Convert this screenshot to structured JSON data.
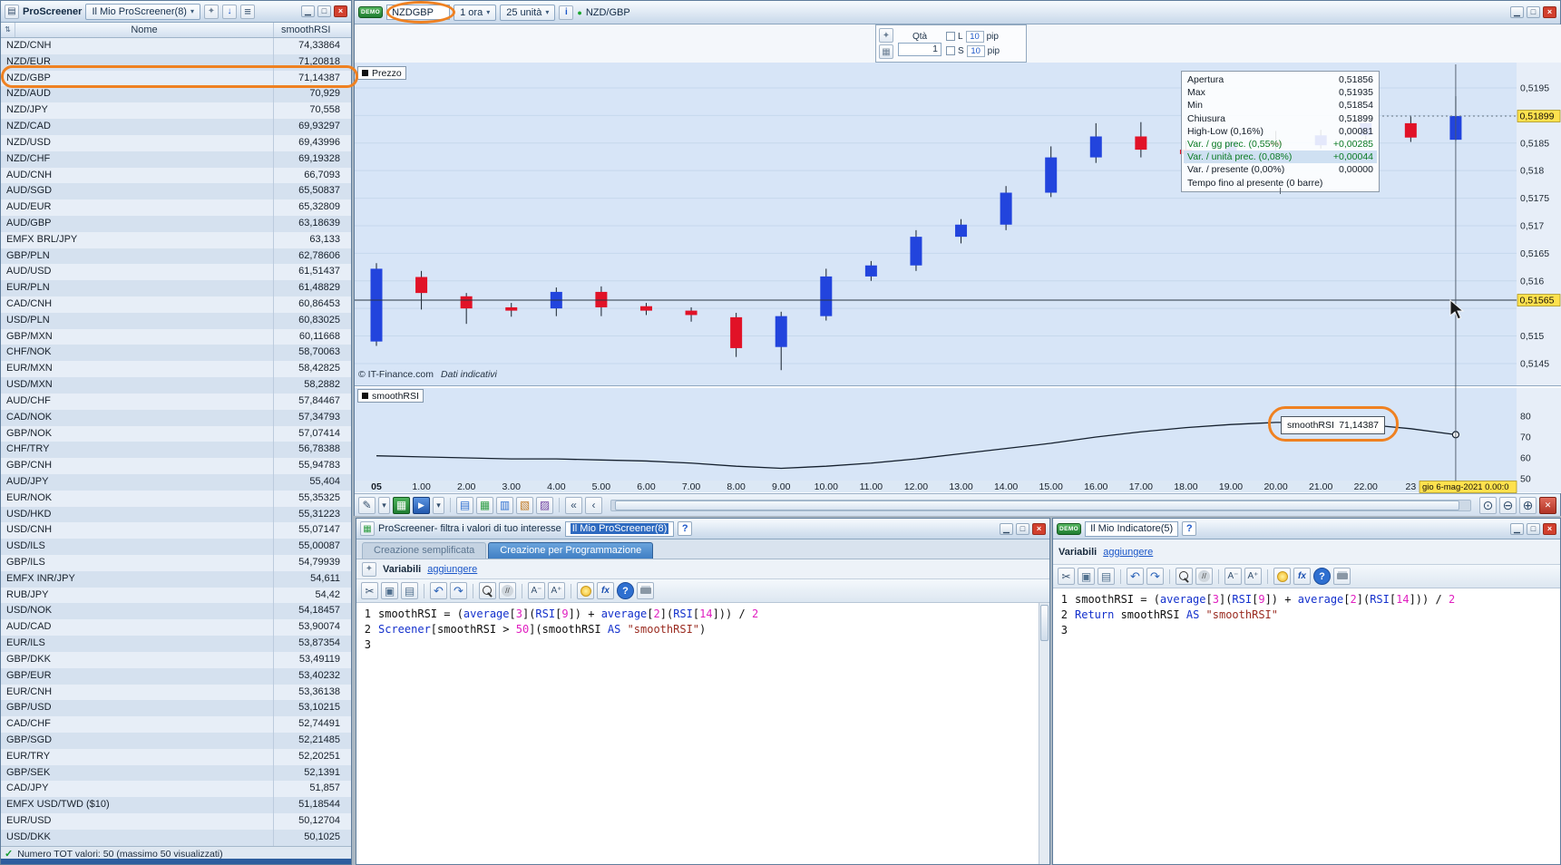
{
  "colors": {
    "up": "#2244dd",
    "down": "#e11227",
    "annotation": "#ef8121",
    "highlight": "#ffe14d",
    "chart_bg": "#d7e5f7"
  },
  "screener_window": {
    "titlebar": {
      "title": "ProScreener",
      "dropdown_label": "Il Mio ProScreener(8)"
    },
    "header": {
      "name_col": "Nome",
      "value_col": "smoothRSI",
      "sort_icon": "⇅"
    },
    "rows": [
      [
        "NZD/CNH",
        "74,33864"
      ],
      [
        "NZD/EUR",
        "71,20818"
      ],
      [
        "NZD/GBP",
        "71,14387"
      ],
      [
        "NZD/AUD",
        "70,929"
      ],
      [
        "NZD/JPY",
        "70,558"
      ],
      [
        "NZD/CAD",
        "69,93297"
      ],
      [
        "NZD/USD",
        "69,43996"
      ],
      [
        "NZD/CHF",
        "69,19328"
      ],
      [
        "AUD/CNH",
        "66,7093"
      ],
      [
        "AUD/SGD",
        "65,50837"
      ],
      [
        "AUD/EUR",
        "65,32809"
      ],
      [
        "AUD/GBP",
        "63,18639"
      ],
      [
        "EMFX BRL/JPY",
        "63,133"
      ],
      [
        "GBP/PLN",
        "62,78606"
      ],
      [
        "AUD/USD",
        "61,51437"
      ],
      [
        "EUR/PLN",
        "61,48829"
      ],
      [
        "CAD/CNH",
        "60,86453"
      ],
      [
        "USD/PLN",
        "60,83025"
      ],
      [
        "GBP/MXN",
        "60,11668"
      ],
      [
        "CHF/NOK",
        "58,70063"
      ],
      [
        "EUR/MXN",
        "58,42825"
      ],
      [
        "USD/MXN",
        "58,2882"
      ],
      [
        "AUD/CHF",
        "57,84467"
      ],
      [
        "CAD/NOK",
        "57,34793"
      ],
      [
        "GBP/NOK",
        "57,07414"
      ],
      [
        "CHF/TRY",
        "56,78388"
      ],
      [
        "GBP/CNH",
        "55,94783"
      ],
      [
        "AUD/JPY",
        "55,404"
      ],
      [
        "EUR/NOK",
        "55,35325"
      ],
      [
        "USD/HKD",
        "55,31223"
      ],
      [
        "USD/CNH",
        "55,07147"
      ],
      [
        "USD/ILS",
        "55,00087"
      ],
      [
        "GBP/ILS",
        "54,79939"
      ],
      [
        "EMFX INR/JPY",
        "54,611"
      ],
      [
        "RUB/JPY",
        "54,42"
      ],
      [
        "USD/NOK",
        "54,18457"
      ],
      [
        "AUD/CAD",
        "53,90074"
      ],
      [
        "EUR/ILS",
        "53,87354"
      ],
      [
        "GBP/DKK",
        "53,49119"
      ],
      [
        "GBP/EUR",
        "53,40232"
      ],
      [
        "EUR/CNH",
        "53,36138"
      ],
      [
        "GBP/USD",
        "53,10215"
      ],
      [
        "CAD/CHF",
        "52,74491"
      ],
      [
        "GBP/SGD",
        "52,21485"
      ],
      [
        "EUR/TRY",
        "52,20251"
      ],
      [
        "GBP/SEK",
        "52,1391"
      ],
      [
        "CAD/JPY",
        "51,857"
      ],
      [
        "EMFX USD/TWD ($10)",
        "51,18544"
      ],
      [
        "EUR/USD",
        "50,12704"
      ],
      [
        "USD/DKK",
        "50,1025"
      ]
    ],
    "selected_row": "NZD/GBP",
    "status": "Numero TOT valori: 50 (massimo 50 visualizzati)"
  },
  "chart_window": {
    "titlebar": {
      "demo_badge": "DEMO",
      "symbol_input": "NZDGBP",
      "timeframe": "1 ora",
      "units": "25 unità",
      "info_icon": "i",
      "symbol_label": "NZD/GBP"
    },
    "order_panel": {
      "qty_label": "Qtà",
      "qty_value": "1",
      "long_label": "L",
      "short_label": "S",
      "long_pips": "10",
      "short_pips": "10",
      "pip_label": "pip"
    },
    "pane_labels": {
      "price": "Prezzo",
      "rsi": "smoothRSI"
    },
    "copyright": "© IT-Finance.com",
    "disclaimer": "Dati indicativi",
    "info_tooltip": [
      {
        "label": "Apertura",
        "value": "0,51856",
        "style": "normal"
      },
      {
        "label": "Max",
        "value": "0,51935",
        "style": "normal"
      },
      {
        "label": "Min",
        "value": "0,51854",
        "style": "normal"
      },
      {
        "label": "Chiusura",
        "value": "0,51899",
        "style": "normal"
      },
      {
        "label": "High-Low (0,16%)",
        "value": "0,00081",
        "style": "normal"
      },
      {
        "label": "Var. / gg prec. (0,55%)",
        "value": "+0,00285",
        "style": "green"
      },
      {
        "label": "Var. / unità prec. (0,08%)",
        "value": "+0,00044",
        "style": "green-selected"
      },
      {
        "label": "Var. / presente (0,00%)",
        "value": "0,00000",
        "style": "normal"
      },
      {
        "label": "Tempo fino al presente (0 barre)",
        "value": "",
        "style": "normal"
      }
    ],
    "rsi_tooltip": {
      "label": "smoothRSI",
      "value": "71,14387"
    },
    "axis": {
      "highlight_last": "0,51899",
      "highlight_cursor": "0,51565",
      "date_label": "gio 6-mag-2021 0.00:0"
    },
    "toolbar": {
      "left_icons": [
        "pencil",
        "dropdown",
        "chart-green",
        "share-blue",
        "dropdown",
        "sep",
        "list",
        "grid",
        "columns",
        "calendar",
        "chart2",
        "sep",
        "collapse",
        "step-back"
      ],
      "right_icons": [
        "zoom-fit",
        "zoom-out",
        "zoom-in",
        "snapshot"
      ]
    }
  },
  "chart_data": {
    "type": "candlestick",
    "symbol": "NZD/GBP",
    "timeframe": "1 ora",
    "visible_bars": 25,
    "x_labels": [
      "05",
      "1.00",
      "2.00",
      "3.00",
      "4.00",
      "5.00",
      "6.00",
      "7.00",
      "8.00",
      "9.00",
      "10.00",
      "11.00",
      "12.00",
      "13.00",
      "14.00",
      "15.00",
      "16.00",
      "17.00",
      "18.00",
      "19.00",
      "20.00",
      "21.00",
      "22.00",
      "23",
      ""
    ],
    "candles": [
      [
        0.5149,
        0.51632,
        0.51482,
        0.51622
      ],
      [
        0.51607,
        0.51618,
        0.51548,
        0.51578
      ],
      [
        0.51572,
        0.51578,
        0.51522,
        0.5155
      ],
      [
        0.51552,
        0.5156,
        0.51535,
        0.51546
      ],
      [
        0.5155,
        0.51588,
        0.51536,
        0.5158
      ],
      [
        0.5158,
        0.5159,
        0.51536,
        0.51552
      ],
      [
        0.51554,
        0.5156,
        0.51538,
        0.51546
      ],
      [
        0.51546,
        0.51552,
        0.51526,
        0.51538
      ],
      [
        0.51534,
        0.51542,
        0.51462,
        0.51478
      ],
      [
        0.5148,
        0.51544,
        0.51438,
        0.51536
      ],
      [
        0.51536,
        0.51622,
        0.51528,
        0.51608
      ],
      [
        0.51608,
        0.51636,
        0.516,
        0.51628
      ],
      [
        0.51628,
        0.51692,
        0.51618,
        0.5168
      ],
      [
        0.5168,
        0.51712,
        0.51668,
        0.51702
      ],
      [
        0.51702,
        0.51772,
        0.51692,
        0.5176
      ],
      [
        0.5176,
        0.51844,
        0.51752,
        0.51824
      ],
      [
        0.51824,
        0.51886,
        0.51814,
        0.51862
      ],
      [
        0.51862,
        0.51888,
        0.51824,
        0.51838
      ],
      [
        0.51838,
        0.51854,
        0.51812,
        0.5183
      ],
      [
        0.5183,
        0.51862,
        0.51822,
        0.51852
      ],
      [
        0.51852,
        0.51872,
        0.51834,
        0.51846
      ],
      [
        0.51846,
        0.51874,
        0.5184,
        0.51864
      ],
      [
        0.51864,
        0.51896,
        0.51852,
        0.51886
      ],
      [
        0.51886,
        0.51898,
        0.51852,
        0.5186
      ],
      [
        0.51856,
        0.51935,
        0.51854,
        0.51899
      ]
    ],
    "last_price": 0.51899,
    "cursor_price": 0.51565,
    "price_gridlines": [
      0.5145,
      0.515,
      0.5155,
      0.516,
      0.5165,
      0.517,
      0.5175,
      0.518,
      0.5185,
      0.519,
      0.5195
    ],
    "price_axis_ticks": [
      {
        "v": 0.5195,
        "label": "0,5195"
      },
      {
        "v": 0.5185,
        "label": "0,5185"
      },
      {
        "v": 0.518,
        "label": "0,518"
      },
      {
        "v": 0.5175,
        "label": "0,5175"
      },
      {
        "v": 0.517,
        "label": "0,517"
      },
      {
        "v": 0.5165,
        "label": "0,5165"
      },
      {
        "v": 0.516,
        "label": "0,516"
      },
      {
        "v": 0.515,
        "label": "0,515"
      },
      {
        "v": 0.5145,
        "label": "0,5145"
      }
    ],
    "indicator": {
      "name": "smoothRSI",
      "values": [
        61,
        60.5,
        60,
        59.5,
        59.5,
        59,
        58.5,
        57.5,
        56,
        55,
        56,
        57.5,
        59.5,
        62,
        64.5,
        67,
        70,
        72.5,
        74.5,
        76,
        77,
        77,
        76,
        74,
        71.14387
      ],
      "axis_ticks": [
        80,
        70,
        60,
        50
      ],
      "last_value": 71.14387
    }
  },
  "screener_editor": {
    "titlebar": {
      "title": "ProScreener- filtra i valori di tuo interesse",
      "tab": "Il Mio ProScreener(8)",
      "help": "?"
    },
    "tabs": [
      {
        "label": "Creazione semplificata",
        "active": false
      },
      {
        "label": "Creazione per Programmazione",
        "active": true
      }
    ],
    "variables_label": "Variabili",
    "add_link": "aggiungere",
    "code": [
      {
        "num": "1",
        "tokens": [
          [
            "smoothRSI = (",
            "p"
          ],
          [
            "average",
            "k"
          ],
          [
            "[",
            "p"
          ],
          [
            "3",
            "n"
          ],
          [
            "](",
            "p"
          ],
          [
            "RSI",
            "k"
          ],
          [
            "[",
            "p"
          ],
          [
            "9",
            "n"
          ],
          [
            "]) + ",
            "p"
          ],
          [
            "average",
            "k"
          ],
          [
            "[",
            "p"
          ],
          [
            "2",
            "n"
          ],
          [
            "](",
            "p"
          ],
          [
            "RSI",
            "k"
          ],
          [
            "[",
            "p"
          ],
          [
            "14",
            "n"
          ],
          [
            "])) / ",
            "p"
          ],
          [
            "2",
            "n"
          ]
        ]
      },
      {
        "num": "2",
        "tokens": [
          [
            "Screener",
            "k"
          ],
          [
            "[smoothRSI > ",
            "p"
          ],
          [
            "50",
            "n"
          ],
          [
            "](smoothRSI ",
            "p"
          ],
          [
            "AS",
            "k"
          ],
          [
            " ",
            "p"
          ],
          [
            "\"smoothRSI\"",
            "s"
          ],
          [
            ")",
            "p"
          ]
        ]
      },
      {
        "num": "3",
        "tokens": []
      }
    ]
  },
  "indicator_editor": {
    "titlebar": {
      "demo_badge": "DEMO",
      "tab": "Il Mio Indicatore(5)",
      "help": "?"
    },
    "variables_label": "Variabili",
    "add_link": "aggiungere",
    "code": [
      {
        "num": "1",
        "tokens": [
          [
            "smoothRSI = (",
            "p"
          ],
          [
            "average",
            "k"
          ],
          [
            "[",
            "p"
          ],
          [
            "3",
            "n"
          ],
          [
            "](",
            "p"
          ],
          [
            "RSI",
            "k"
          ],
          [
            "[",
            "p"
          ],
          [
            "9",
            "n"
          ],
          [
            "]) + ",
            "p"
          ],
          [
            "average",
            "k"
          ],
          [
            "[",
            "p"
          ],
          [
            "2",
            "n"
          ],
          [
            "](",
            "p"
          ],
          [
            "RSI",
            "k"
          ],
          [
            "[",
            "p"
          ],
          [
            "14",
            "n"
          ],
          [
            "])) / ",
            "p"
          ],
          [
            "2",
            "n"
          ]
        ]
      },
      {
        "num": "2",
        "tokens": [
          [
            "Return",
            "k"
          ],
          [
            " smoothRSI ",
            "p"
          ],
          [
            "AS",
            "k"
          ],
          [
            " ",
            "p"
          ],
          [
            "\"smoothRSI\"",
            "s"
          ]
        ]
      },
      {
        "num": "3",
        "tokens": []
      }
    ]
  },
  "editor_toolbar_icons": [
    "cut",
    "copy",
    "paste",
    "sep",
    "undo",
    "redo",
    "sep",
    "search",
    "comment",
    "sep",
    "font-decrease",
    "font-increase",
    "sep",
    "hint",
    "function",
    "help-circ",
    "print"
  ]
}
